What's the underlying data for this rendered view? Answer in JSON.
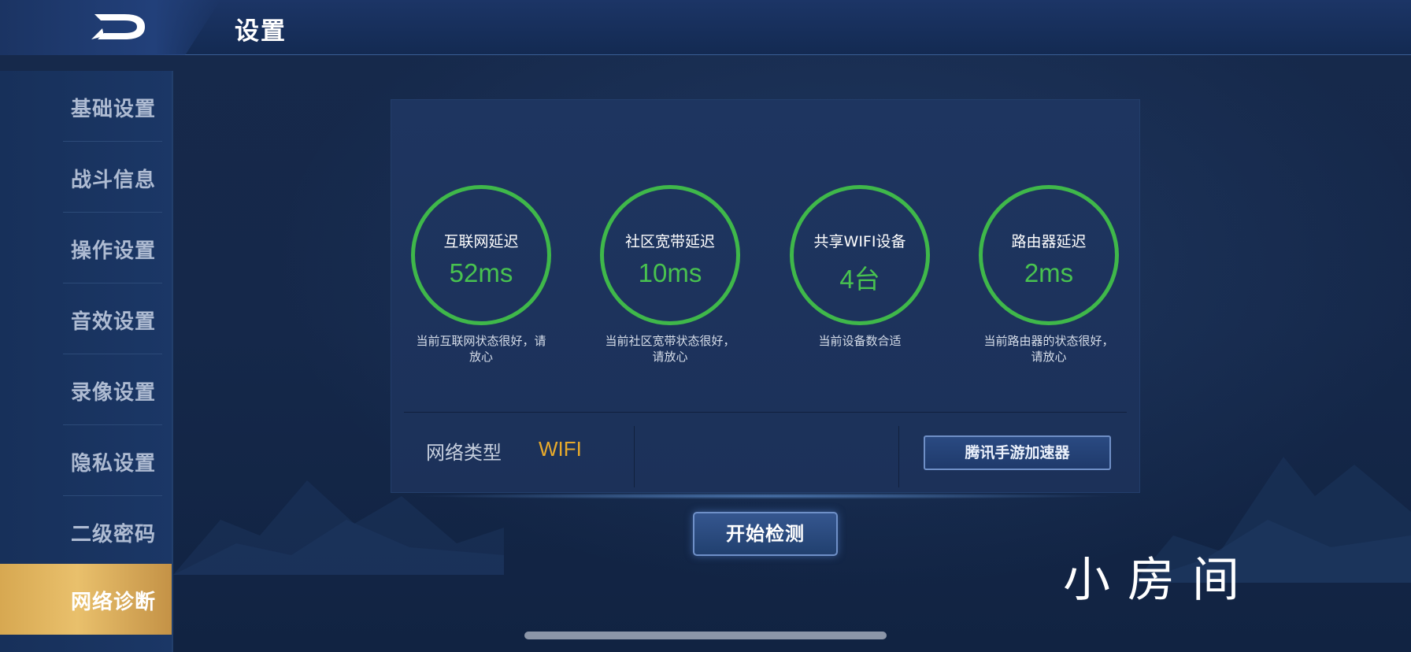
{
  "header": {
    "title": "设置",
    "back_icon": "back-icon"
  },
  "sidebar": {
    "items": [
      {
        "label": "基础设置",
        "active": false
      },
      {
        "label": "战斗信息",
        "active": false
      },
      {
        "label": "操作设置",
        "active": false
      },
      {
        "label": "音效设置",
        "active": false
      },
      {
        "label": "录像设置",
        "active": false
      },
      {
        "label": "隐私设置",
        "active": false
      },
      {
        "label": "二级密码",
        "active": false
      },
      {
        "label": "网络诊断",
        "active": true
      }
    ]
  },
  "stats": [
    {
      "label": "互联网延迟",
      "value": "52ms",
      "note": "当前互联网状态很好，请放心"
    },
    {
      "label": "社区宽带延迟",
      "value": "10ms",
      "note": "当前社区宽带状态很好，请放心"
    },
    {
      "label": "共享WIFI设备",
      "value": "4台",
      "note": "当前设备数合适"
    },
    {
      "label": "路由器延迟",
      "value": "2ms",
      "note": "当前路由器的状态很好，请放心"
    }
  ],
  "network": {
    "type_label": "网络类型",
    "type_value": "WIFI",
    "accelerator_button": "腾讯手游加速器"
  },
  "start_button": "开始检测",
  "watermark": "小房间",
  "colors": {
    "ring": "#3fb84a",
    "value": "#48c24f",
    "network_type": "#e8aa2b",
    "active_tab": "#e2b860"
  }
}
